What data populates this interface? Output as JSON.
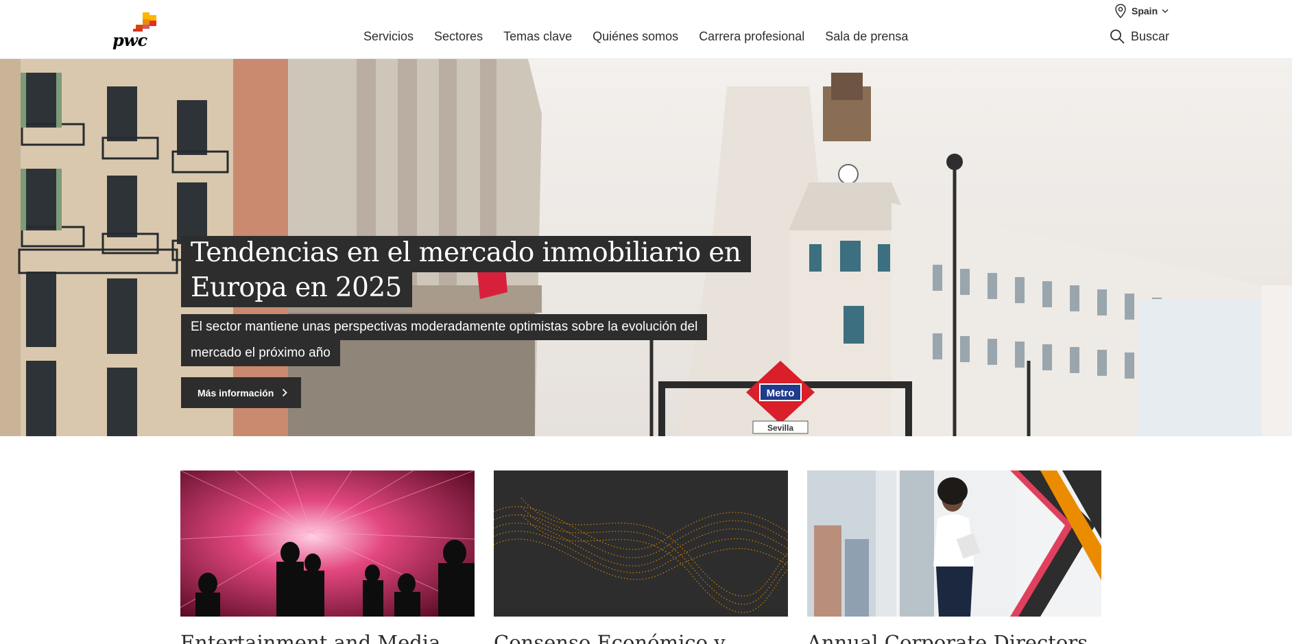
{
  "header": {
    "logo_text": "pwc",
    "locale": {
      "label": "Spain",
      "icon": "location-pin-icon",
      "chevron": "chevron-down-icon"
    },
    "nav": [
      {
        "label": "Servicios"
      },
      {
        "label": "Sectores"
      },
      {
        "label": "Temas clave"
      },
      {
        "label": "Quiénes somos"
      },
      {
        "label": "Carrera profesional"
      },
      {
        "label": "Sala de prensa"
      }
    ],
    "search": {
      "label": "Buscar",
      "icon": "search-icon"
    }
  },
  "hero": {
    "title_line1": "Tendencias en el mercado inmobiliario en",
    "title_line2": "Europa en 2025",
    "subtitle_line1": "El sector mantiene unas perspectivas moderadamente optimistas sobre la evolución del",
    "subtitle_line2": "mercado el próximo año",
    "cta_label": "Más información",
    "cta_icon": "chevron-right-icon",
    "metro_sign": "Metro",
    "street_sign": "Sevilla"
  },
  "cards": [
    {
      "title": "Entertainment and Media",
      "image": "light-installation-silhouettes"
    },
    {
      "title": "Consenso Económico y",
      "image": "orange-dot-wave"
    },
    {
      "title": "Annual Corporate Directors",
      "image": "businesswoman-window"
    }
  ],
  "colors": {
    "brand_orange": "#d04a02",
    "brand_yellow": "#ffb600",
    "brand_red": "#e0301e",
    "dark_overlay": "#2d2d2d",
    "text": "#2d2d2d"
  }
}
